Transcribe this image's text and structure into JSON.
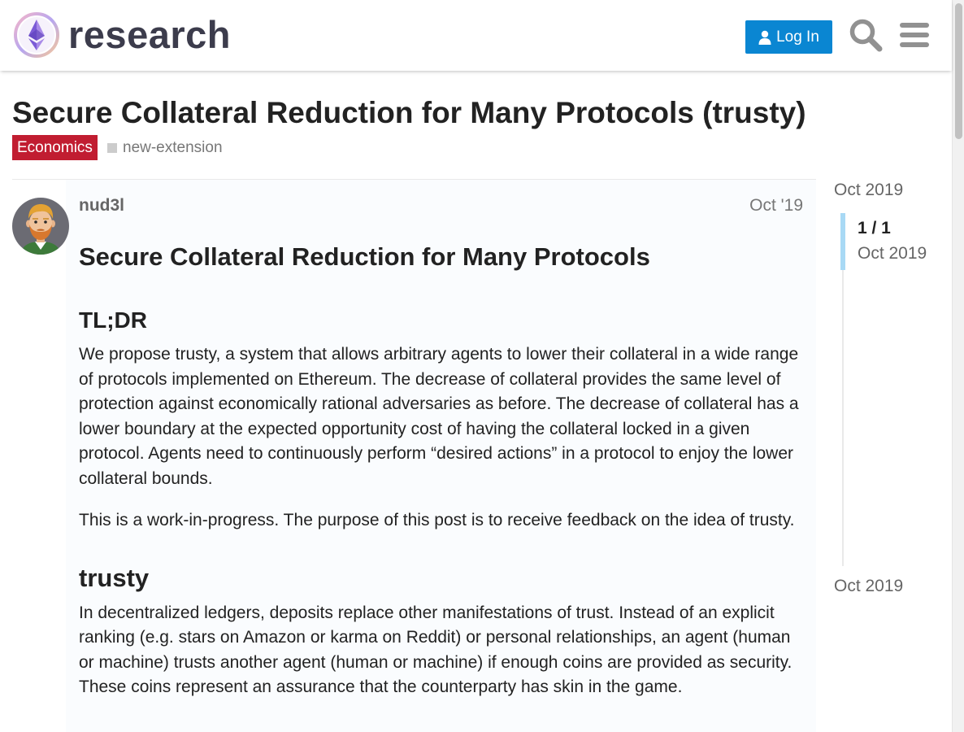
{
  "header": {
    "logo_text": "research",
    "login_label": "Log In"
  },
  "topic": {
    "title": "Secure Collateral Reduction for Many Protocols (trusty)",
    "category": "Economics",
    "category_color": "#c11d31",
    "tag": "new-extension"
  },
  "post": {
    "username": "nud3l",
    "date": "Oct '19",
    "heading": "Secure Collateral Reduction for Many Protocols",
    "section1_title": "TL;DR",
    "paragraph1": "We propose trusty, a system that allows arbitrary agents to lower their collateral in a wide range of protocols implemented on Ethereum. The decrease of collateral provides the same level of protection against economically rational adversaries as before. The decrease of collateral has a lower boundary at the expected opportunity cost of having the collateral locked in a given protocol. Agents need to continuously perform “desired actions” in a protocol to enjoy the lower collateral bounds.",
    "paragraph2": "This is a work-in-progress. The purpose of this post is to receive feedback on the idea of trusty.",
    "section2_title": "trusty",
    "paragraph3": "In decentralized ledgers, deposits replace other manifestations of trust. Instead of an explicit ranking (e.g. stars on Amazon or karma on Reddit) or personal relationships, an agent (human or machine) trusts another agent (human or machine) if enough coins are provided as security. These coins represent an assurance that the counterparty has skin in the game."
  },
  "timeline": {
    "start_date": "Oct 2019",
    "position": "1 / 1",
    "position_date": "Oct 2019",
    "end_date": "Oct 2019"
  },
  "colors": {
    "accent": "#0a86d2",
    "timeline_handle": "#a8d9f5"
  }
}
